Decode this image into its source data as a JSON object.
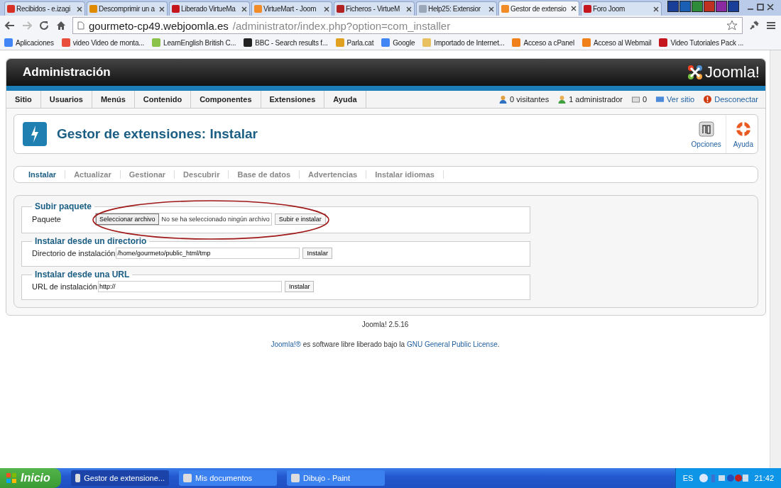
{
  "browser_tabs": [
    {
      "title": "Recibidos - e.izagi",
      "selected": false,
      "color": "#d93025"
    },
    {
      "title": "Descomprimir un a",
      "selected": false,
      "color": "#e08a00"
    },
    {
      "title": "Liberado VirtueMa",
      "selected": false,
      "color": "#c4161c"
    },
    {
      "title": "VirtueMart - Joom",
      "selected": false,
      "color": "#f28c28"
    },
    {
      "title": "Ficheros - VirtueM",
      "selected": false,
      "color": "#b22222"
    },
    {
      "title": "Help25: Extensior",
      "selected": false,
      "color": "#9aa7b8"
    },
    {
      "title": "Gestor de extensio",
      "selected": true,
      "color": "#f28c28"
    },
    {
      "title": "Foro Joom",
      "selected": false,
      "color": "#c4161c"
    }
  ],
  "address": {
    "host": "gourmeto-cp49.webjoomla.es",
    "path": "/administrator/index.php?option=com_installer"
  },
  "bookmarks": [
    {
      "label": "Aplicaciones",
      "color": "#4285f4"
    },
    {
      "label": "video Video de monta...",
      "color": "#e94e3c"
    },
    {
      "label": "LearnEnglish British C...",
      "color": "#8bc34a"
    },
    {
      "label": "BBC - Search results f...",
      "color": "#222222"
    },
    {
      "label": "Parla.cat",
      "color": "#e0a020"
    },
    {
      "label": "Google",
      "color": "#4285f4"
    },
    {
      "label": "Importado de Internet...",
      "color": "#e8c060"
    },
    {
      "label": "Acceso a cPanel",
      "color": "#f0801a"
    },
    {
      "label": "Acceso al Webmail",
      "color": "#f0801a"
    },
    {
      "label": "Video Tutoriales Pack ...",
      "color": "#c4161c"
    }
  ],
  "header": {
    "title": "Administración",
    "logo": "Joomla!"
  },
  "menu": [
    "Sitio",
    "Usuarios",
    "Menús",
    "Contenido",
    "Componentes",
    "Extensiones",
    "Ayuda"
  ],
  "status": [
    {
      "kind": "visitors",
      "text": "0 visitantes"
    },
    {
      "kind": "admins",
      "text": "1 administrador"
    },
    {
      "kind": "messages",
      "text": "0"
    },
    {
      "kind": "view",
      "text": "Ver sitio"
    },
    {
      "kind": "logout",
      "text": "Desconectar"
    }
  ],
  "page_title": "Gestor de extensiones: Instalar",
  "toolbar": [
    {
      "kind": "options",
      "label": "Opciones"
    },
    {
      "kind": "help",
      "label": "Ayuda"
    }
  ],
  "subtabs": [
    {
      "label": "Instalar",
      "selected": true
    },
    {
      "label": "Actualizar",
      "selected": false
    },
    {
      "label": "Gestionar",
      "selected": false
    },
    {
      "label": "Descubrir",
      "selected": false
    },
    {
      "label": "Base de datos",
      "selected": false
    },
    {
      "label": "Advertencias",
      "selected": false
    },
    {
      "label": "Instalar idiomas",
      "selected": false
    }
  ],
  "sections": [
    {
      "kind": "file",
      "legend": "Subir paquete",
      "label": "Paquete",
      "choose_button": "Seleccionar archivo",
      "file_status": "No se ha seleccionado ningún archivo",
      "button": "Subir e instalar"
    },
    {
      "kind": "text",
      "legend": "Instalar desde un directorio",
      "label": "Directorio de instalación",
      "value": "/home/gourmeto/public_html/tmp",
      "button": "Instalar"
    },
    {
      "kind": "text",
      "legend": "Instalar desde una URL",
      "label": "URL de instalación",
      "value": "http://",
      "button": "Instalar"
    }
  ],
  "footer": {
    "version": "Joomla! 2.5.16",
    "license_link1": "Joomla!®",
    "license_text": "es software libre liberado bajo la",
    "license_link2": "GNU General Public License",
    "license_end": "."
  },
  "taskbar": {
    "start": "Inicio",
    "tasks": [
      {
        "label": "Gestor de extensione...",
        "selected": true
      },
      {
        "label": "Mis documentos",
        "selected": false
      },
      {
        "label": "Dibujo - Paint",
        "selected": false
      }
    ],
    "language": "ES",
    "clock": "21:42"
  }
}
